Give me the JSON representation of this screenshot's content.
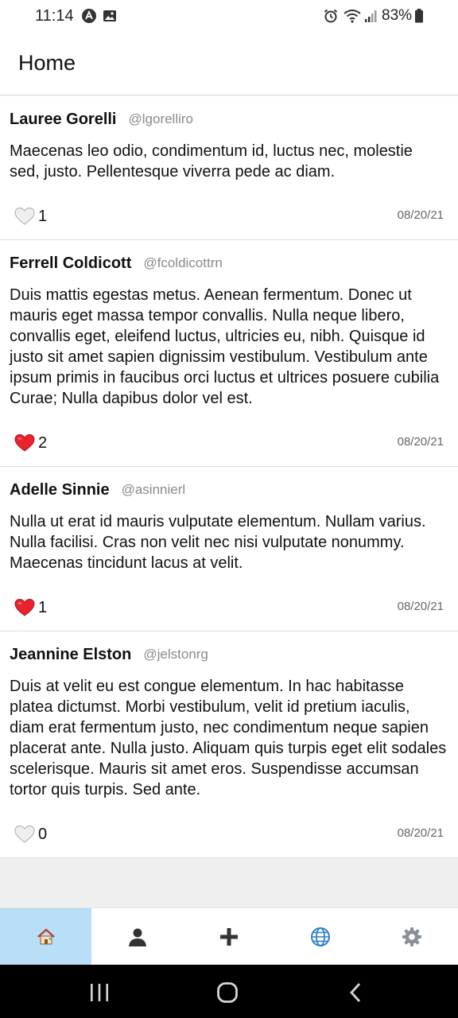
{
  "status_bar": {
    "time": "11:14",
    "battery": "83%"
  },
  "header": {
    "title": "Home"
  },
  "posts": [
    {
      "author": "Lauree Gorelli",
      "handle": "@lgorelliro",
      "body": "Maecenas leo odio, condimentum id, luctus nec, molestie sed, justo. Pellentesque viverra pede ac diam.",
      "likes": "1",
      "liked": false,
      "date": "08/20/21"
    },
    {
      "author": "Ferrell Coldicott",
      "handle": "@fcoldicottrn",
      "body": "Duis mattis egestas metus. Aenean fermentum. Donec ut mauris eget massa tempor convallis. Nulla neque libero, convallis eget, eleifend luctus, ultricies eu, nibh. Quisque id justo sit amet sapien dignissim vestibulum. Vestibulum ante ipsum primis in faucibus orci luctus et ultrices posuere cubilia Curae; Nulla dapibus dolor vel est.",
      "likes": "2",
      "liked": true,
      "date": "08/20/21"
    },
    {
      "author": "Adelle Sinnie",
      "handle": "@asinnierl",
      "body": "Nulla ut erat id mauris vulputate elementum. Nullam varius. Nulla facilisi. Cras non velit nec nisi vulputate nonummy. Maecenas tincidunt lacus at velit.",
      "likes": "1",
      "liked": true,
      "date": "08/20/21"
    },
    {
      "author": "Jeannine Elston",
      "handle": "@jelstonrg",
      "body": "Duis at velit eu est congue elementum. In hac habitasse platea dictumst. Morbi vestibulum, velit id pretium iaculis, diam erat fermentum justo, nec condimentum neque sapien placerat ante. Nulla justo. Aliquam quis turpis eget elit sodales scelerisque. Mauris sit amet eros. Suspendisse accumsan tortor quis turpis. Sed ante.",
      "likes": "0",
      "liked": false,
      "date": "08/20/21"
    }
  ],
  "tab_bar": {
    "active_tab": "home",
    "tabs": [
      "home-icon",
      "profile-icon",
      "add-icon",
      "globe-icon",
      "settings-icon"
    ],
    "active_color": "#b9def8"
  },
  "colors": {
    "liked_heart": "#e8232e",
    "unliked_heart": "#ececec",
    "globe": "#2c7fc9"
  }
}
